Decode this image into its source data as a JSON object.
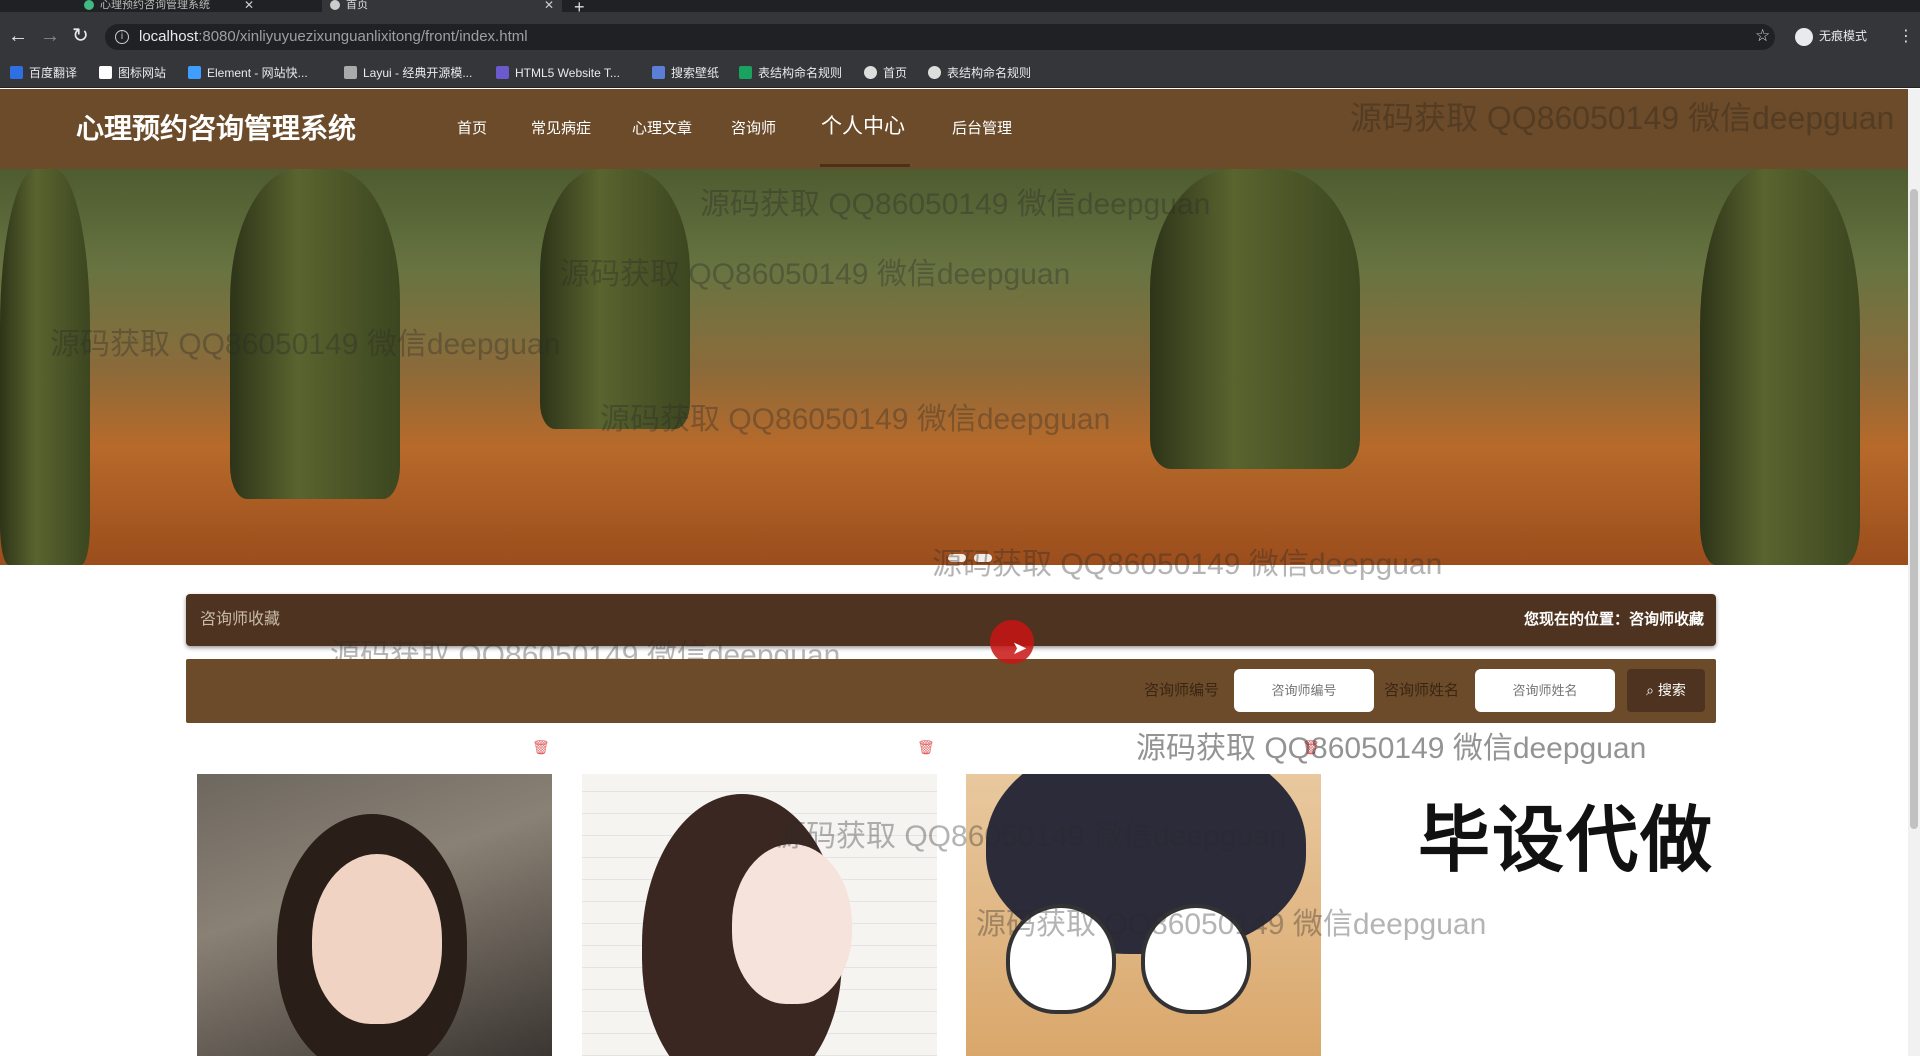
{
  "browser": {
    "tabs": [
      {
        "title": "心理预约咨询管理系统"
      },
      {
        "title": "首页"
      }
    ],
    "url_host": "localhost",
    "url_path": ":8080/xinliyuyuezixunguanlixitong/front/index.html",
    "profile_label": "无痕模式",
    "bookmarks": [
      {
        "label": "百度翻译"
      },
      {
        "label": "图标网站"
      },
      {
        "label": "Element - 网站快..."
      },
      {
        "label": "Layui - 经典开源模..."
      },
      {
        "label": "HTML5 Website T..."
      },
      {
        "label": "搜索壁纸"
      },
      {
        "label": "表结构命名规则"
      },
      {
        "label": "首页"
      },
      {
        "label": "表结构命名规则"
      }
    ]
  },
  "site": {
    "title": "心理预约咨询管理系统",
    "nav": [
      {
        "label": "首页"
      },
      {
        "label": "常见病症"
      },
      {
        "label": "心理文章"
      },
      {
        "label": "咨询师"
      },
      {
        "label": "个人中心"
      },
      {
        "label": "后台管理"
      }
    ],
    "active_nav": "个人中心"
  },
  "breadcrumb": {
    "section": "咨询师收藏",
    "location": "您现在的位置：咨询师收藏"
  },
  "search": {
    "id_label": "咨询师编号",
    "id_placeholder": "咨询师编号",
    "name_label": "咨询师姓名",
    "name_placeholder": "咨询师姓名",
    "button_label": "搜索"
  },
  "promo_text": "毕设代做",
  "watermark": "源码获取 QQ86050149 微信deepguan",
  "colors": {
    "header_bg": "#6b4b2a",
    "dark_brown": "#4e3420",
    "delete_icon": "#e06060"
  }
}
